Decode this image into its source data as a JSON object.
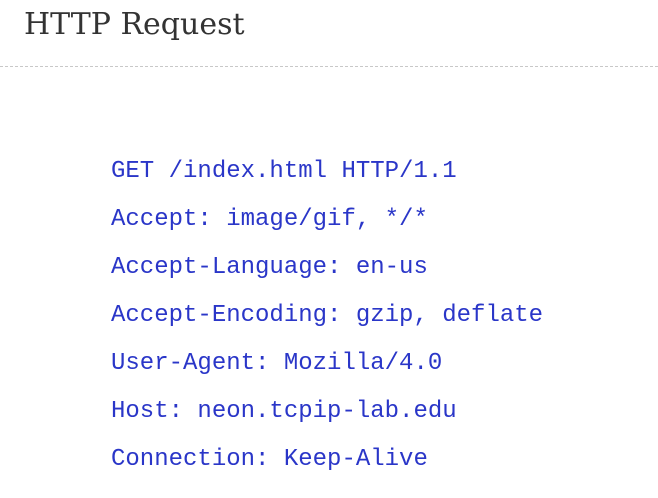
{
  "slide": {
    "title": "HTTP Request",
    "request_lines": [
      "GET /index.html HTTP/1.1",
      "Accept: image/gif, */*",
      "Accept-Language: en-us",
      "Accept-Encoding: gzip, deflate",
      "User-Agent: Mozilla/4.0",
      "Host: neon.tcpip-lab.edu",
      "Connection: Keep-Alive"
    ]
  },
  "colors": {
    "title_text": "#333333",
    "code_text": "#2a36c8",
    "divider": "#c8c8c8",
    "background": "#ffffff"
  }
}
